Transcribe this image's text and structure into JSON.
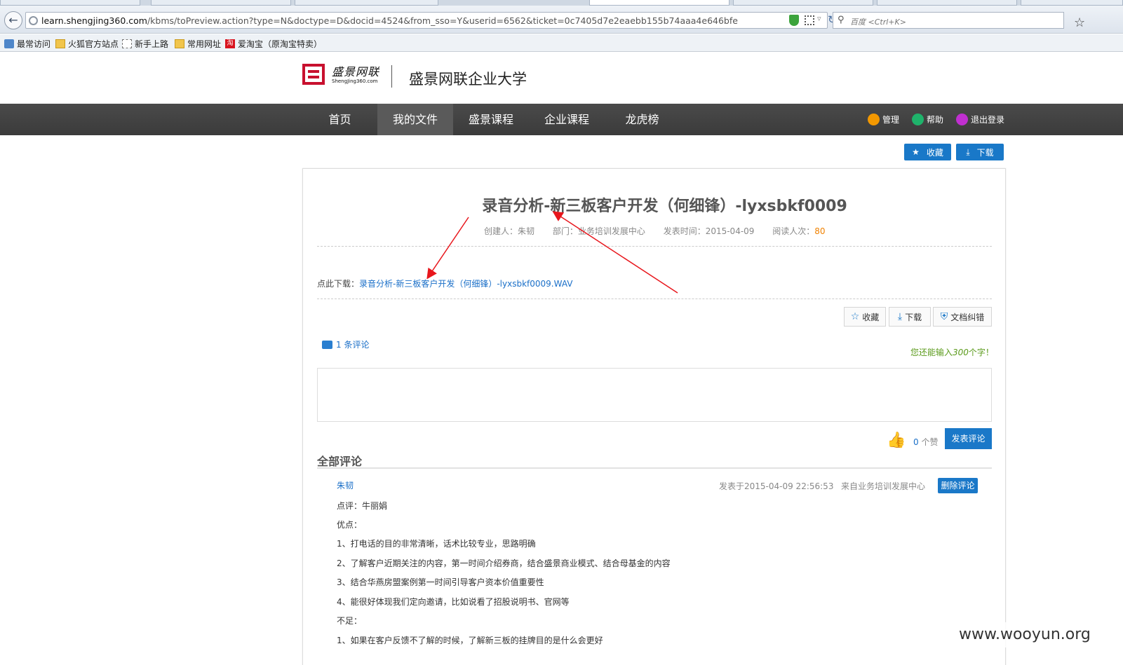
{
  "browser": {
    "url_host": "learn.shengjing360.com",
    "url_path": "/kbms/toPreview.action?type=N&doctype=D&docid=4524&from_sso=Y&userid=6562&ticket=0c7405d7e2eaebb155b74aaa4e646bfe",
    "search_placeholder": "百度 <Ctrl+K>",
    "bookmarks": [
      "最常访问",
      "火狐官方站点",
      "新手上路",
      "常用网址",
      "爱淘宝（原淘宝特卖）"
    ],
    "taobao_glyph": "淘"
  },
  "site": {
    "logo_cn": "盛景网联",
    "logo_en": "ShengJing360.com",
    "title": "盛景网联企业大学",
    "nav": [
      "首页",
      "我的文件",
      "盛景课程",
      "企业课程",
      "龙虎榜"
    ],
    "active_nav": "我的文件",
    "utils": {
      "manage": "管理",
      "help": "帮助",
      "logout": "退出登录"
    },
    "top_buttons": {
      "favorite": "收藏",
      "download": "下载"
    }
  },
  "document": {
    "title": "录音分析-新三板客户开发（何细锋）-lyxsbkf0009",
    "creator_label": "创建人：朱韧",
    "dept_label": "部门：业务培训发展中心",
    "publish_label": "发表时间：2015-04-09",
    "reads_label": "阅读人次：",
    "reads": "80",
    "download_prefix": "点此下载：",
    "download_file": "录音分析-新三板客户开发（何细锋）-lyxsbkf0009.WAV",
    "actions": {
      "favorite": "收藏",
      "download": "下载",
      "correct": "文档纠错"
    }
  },
  "comments": {
    "count_label": "1 条评论",
    "remain_prefix": "您还能输入",
    "remain_num": "300",
    "remain_suffix": "个字！",
    "likes_num": "0",
    "likes_unit": " 个赞",
    "post_label": "发表评论",
    "all_title": "全部评论",
    "items": [
      {
        "author": "朱韧",
        "time": "发表于2015-04-09 22:56:53",
        "dept": "来自业务培训发展中心",
        "delete_label": "删除评论",
        "lines": [
          "点评：牛丽娟",
          "优点：",
          "1、打电话的目的非常清晰，话术比较专业，思路明确",
          "2、了解客户近期关注的内容，第一时间介绍券商，结合盛景商业模式、结合母基金的内容",
          "3、结合华燕房盟案例第一时间引导客户资本价值重要性",
          "4、能很好体现我们定向邀请，比如说看了招股说明书、官网等",
          "不足：",
          "1、如果在客户反馈不了解的时候，了解新三板的挂牌目的是什么会更好"
        ]
      }
    ]
  },
  "watermark": "www.wooyun.org",
  "colors": {
    "accent": "#1a78c8",
    "nav_bg": "#3f3f3f",
    "logo_red": "#c8102e",
    "annotation": "#e8161c"
  }
}
